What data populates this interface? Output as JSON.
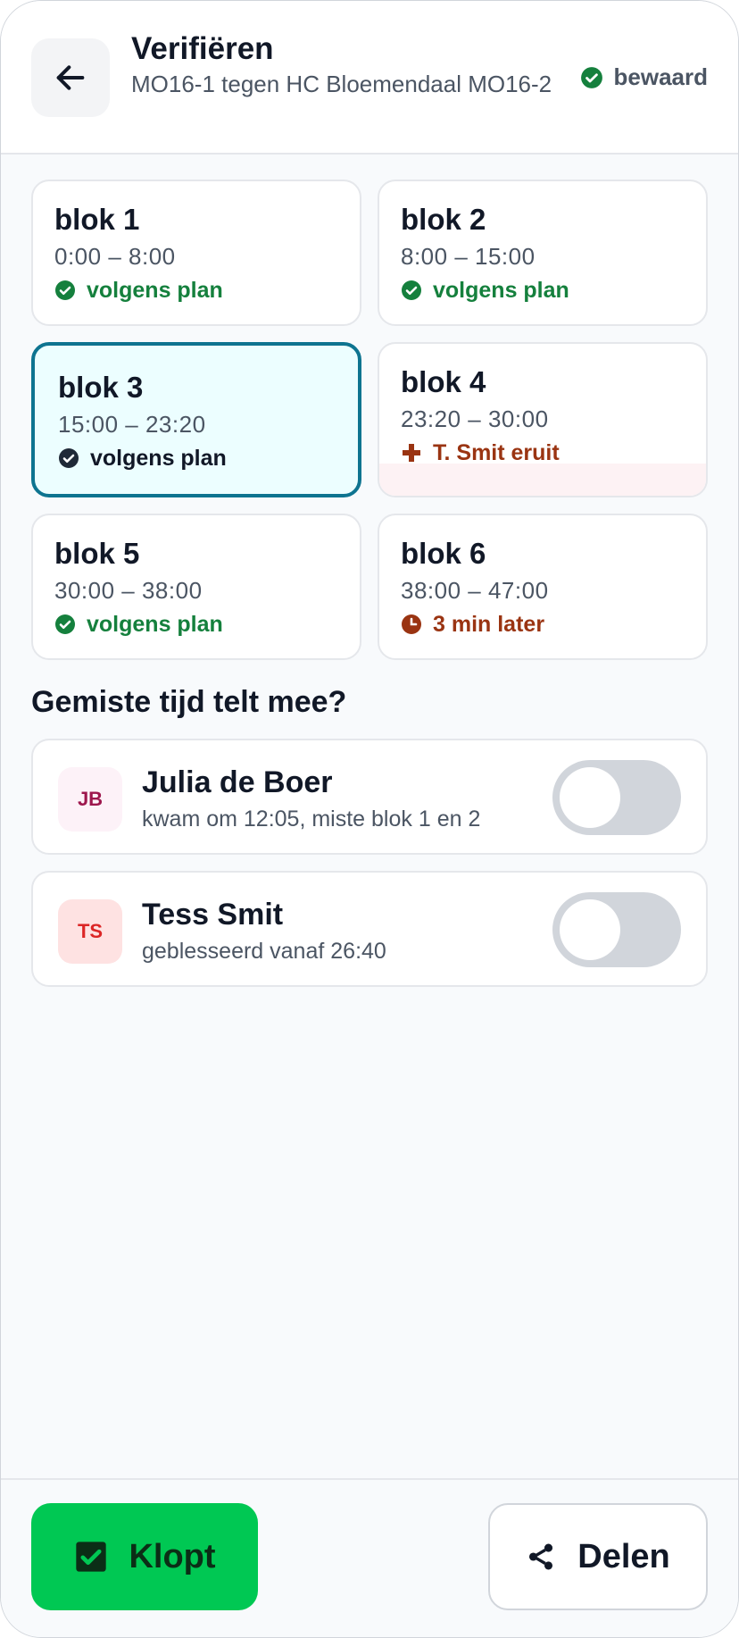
{
  "header": {
    "back_icon": "arrow-left-icon",
    "title": "Verifiëren",
    "subtitle": "MO16-1 tegen HC Bloemendaal MO16-2",
    "saved_label": "bewaard",
    "saved_icon": "check-circle-icon"
  },
  "blocks": [
    {
      "name": "blok 1",
      "time": "0:00 – 8:00",
      "status": "volgens plan",
      "status_icon": "check-circle-icon"
    },
    {
      "name": "blok 2",
      "time": "8:00 – 15:00",
      "status": "volgens plan",
      "status_icon": "check-circle-icon"
    },
    {
      "name": "blok 3",
      "time": "15:00 – 23:20",
      "status": "volgens plan",
      "status_icon": "check-circle-icon",
      "selected": true
    },
    {
      "name": "blok 4",
      "time": "23:20 – 30:00",
      "status": "T. Smit eruit",
      "status_icon": "medical-cross-icon"
    },
    {
      "name": "blok 5",
      "time": "30:00 – 38:00",
      "status": "volgens plan",
      "status_icon": "check-circle-icon"
    },
    {
      "name": "blok 6",
      "time": "38:00 – 47:00",
      "status": "3 min later",
      "status_icon": "clock-icon"
    }
  ],
  "missed": {
    "title": "Gemiste tijd telt mee?",
    "players": [
      {
        "initials": "JB",
        "name": "Julia de Boer",
        "note": "kwam om 12:05, miste blok 1 en 2",
        "toggle_on": false
      },
      {
        "initials": "TS",
        "name": "Tess Smit",
        "note": "geblesseerd vanaf 26:40",
        "toggle_on": false
      }
    ]
  },
  "footer": {
    "confirm_label": "Klopt",
    "confirm_icon": "checkbox-checked-icon",
    "share_label": "Delen",
    "share_icon": "share-icon"
  },
  "colors": {
    "accent_green": "#00c853",
    "ok_green": "#15803d",
    "warning": "#9a3412",
    "selected_border": "#0e7490",
    "selected_bg": "#ecfeff"
  }
}
